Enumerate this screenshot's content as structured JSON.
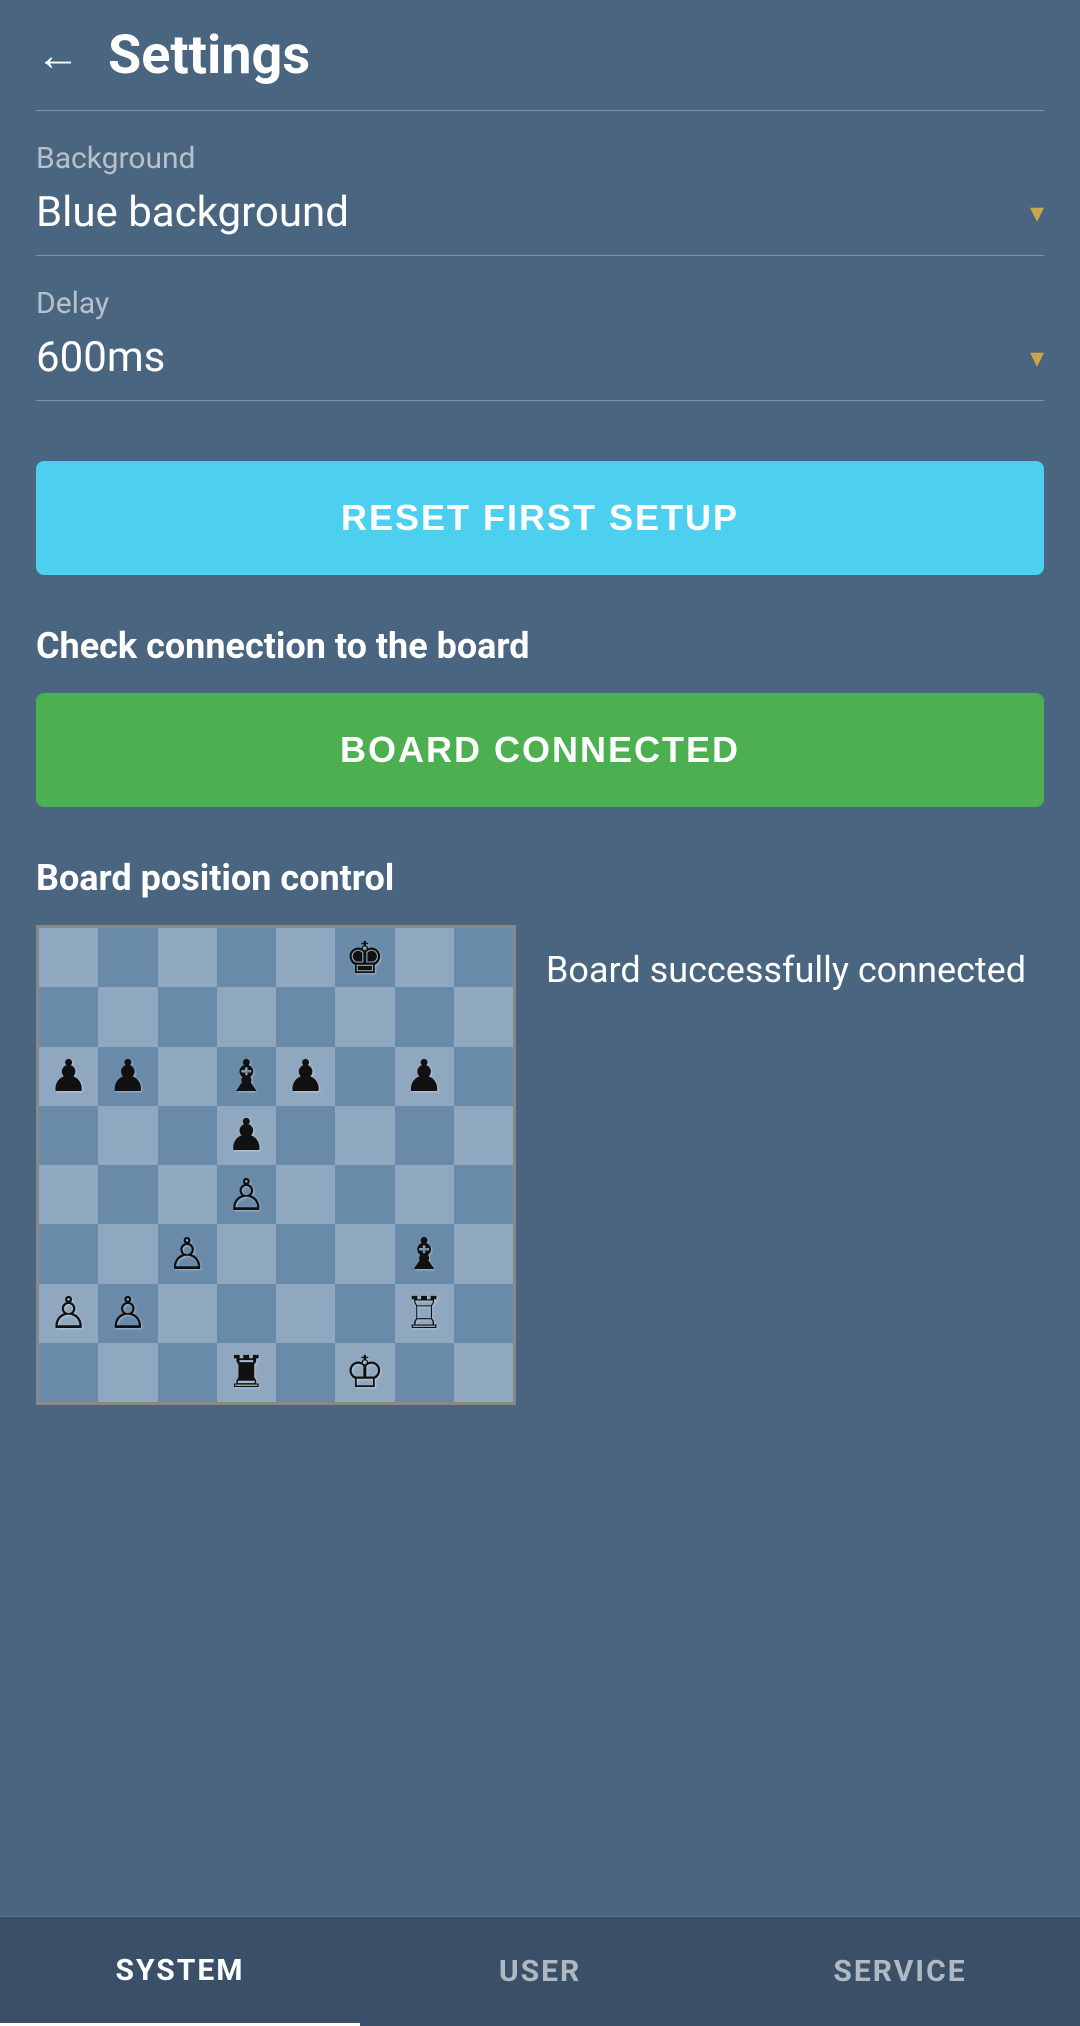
{
  "header": {
    "title": "Settings",
    "back_label": "←"
  },
  "settings": {
    "background_label": "Background",
    "background_value": "Blue background",
    "delay_label": "Delay",
    "delay_value": "600ms"
  },
  "buttons": {
    "reset_first_setup": "RESET FIRST SETUP",
    "board_connected": "BOARD CONNECTED"
  },
  "sections": {
    "check_connection_label": "Check connection to the board",
    "board_position_label": "Board position control",
    "board_status_text": "Board successfully connected"
  },
  "chess_board": {
    "pieces": [
      {
        "row": 0,
        "col": 5,
        "piece": "♚",
        "color": "black"
      },
      {
        "row": 2,
        "col": 0,
        "piece": "♟",
        "color": "black"
      },
      {
        "row": 2,
        "col": 1,
        "piece": "♟",
        "color": "black"
      },
      {
        "row": 2,
        "col": 3,
        "piece": "♝",
        "color": "black"
      },
      {
        "row": 2,
        "col": 4,
        "piece": "♟",
        "color": "black"
      },
      {
        "row": 2,
        "col": 6,
        "piece": "♟",
        "color": "black"
      },
      {
        "row": 3,
        "col": 3,
        "piece": "♟",
        "color": "black"
      },
      {
        "row": 4,
        "col": 3,
        "piece": "♙",
        "color": "white"
      },
      {
        "row": 5,
        "col": 2,
        "piece": "♙",
        "color": "white"
      },
      {
        "row": 5,
        "col": 6,
        "piece": "♝",
        "color": "black"
      },
      {
        "row": 6,
        "col": 0,
        "piece": "♙",
        "color": "white"
      },
      {
        "row": 6,
        "col": 1,
        "piece": "♙",
        "color": "white"
      },
      {
        "row": 6,
        "col": 6,
        "piece": "♖",
        "color": "black"
      },
      {
        "row": 7,
        "col": 3,
        "piece": "♜",
        "color": "black"
      },
      {
        "row": 7,
        "col": 5,
        "piece": "♔",
        "color": "white"
      }
    ]
  },
  "nav": {
    "tabs": [
      {
        "id": "system",
        "label": "SYSTEM",
        "active": true
      },
      {
        "id": "user",
        "label": "USER",
        "active": false
      },
      {
        "id": "service",
        "label": "SERVICE",
        "active": false
      }
    ]
  }
}
